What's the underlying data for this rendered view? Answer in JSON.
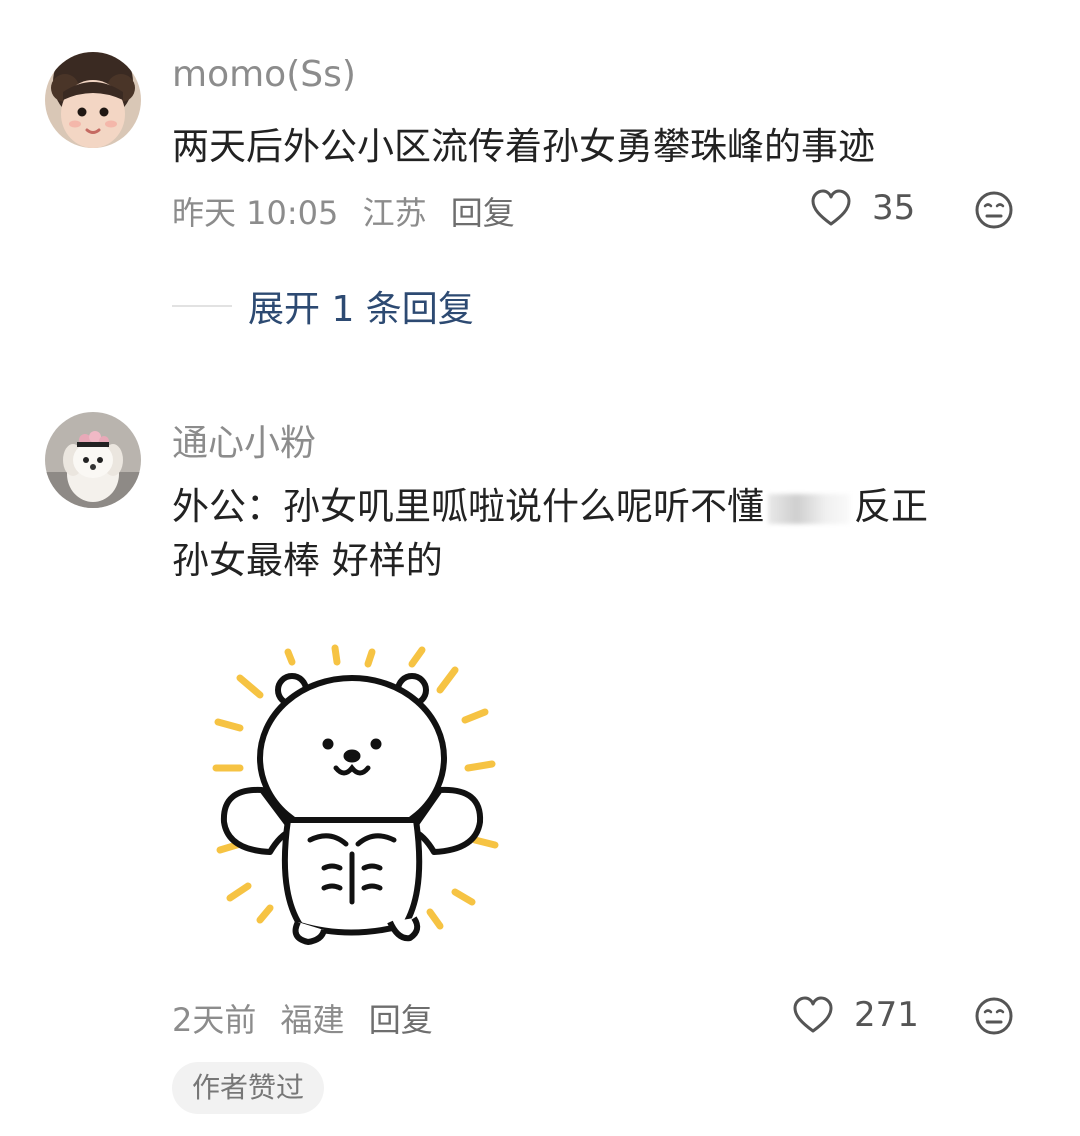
{
  "comments": [
    {
      "username": "momo(Ss)",
      "text": "两天后外公小区流传着孙女勇攀珠峰的事迹",
      "time": "昨天 10:05",
      "location": "江苏",
      "reply_label": "回复",
      "likes": "35",
      "expand_label": "展开 1 条回复",
      "avatar_icon": "baby-avatar"
    },
    {
      "username": "通心小粉",
      "text_part1": "外公：孙女叽里呱啦说什么呢听不懂",
      "text_part2": "反正",
      "text_line2": "孙女最棒 好样的",
      "time": "2天前",
      "location": "福建",
      "reply_label": "回复",
      "likes": "271",
      "badge": "作者赞过",
      "avatar_icon": "white-dog-avatar",
      "sticker_icon": "muscle-bear-sticker"
    }
  ],
  "colors": {
    "username": "#8c8c8c",
    "text": "#222222",
    "expand_link": "#2d4a72",
    "sticker_rays": "#f6c343"
  }
}
